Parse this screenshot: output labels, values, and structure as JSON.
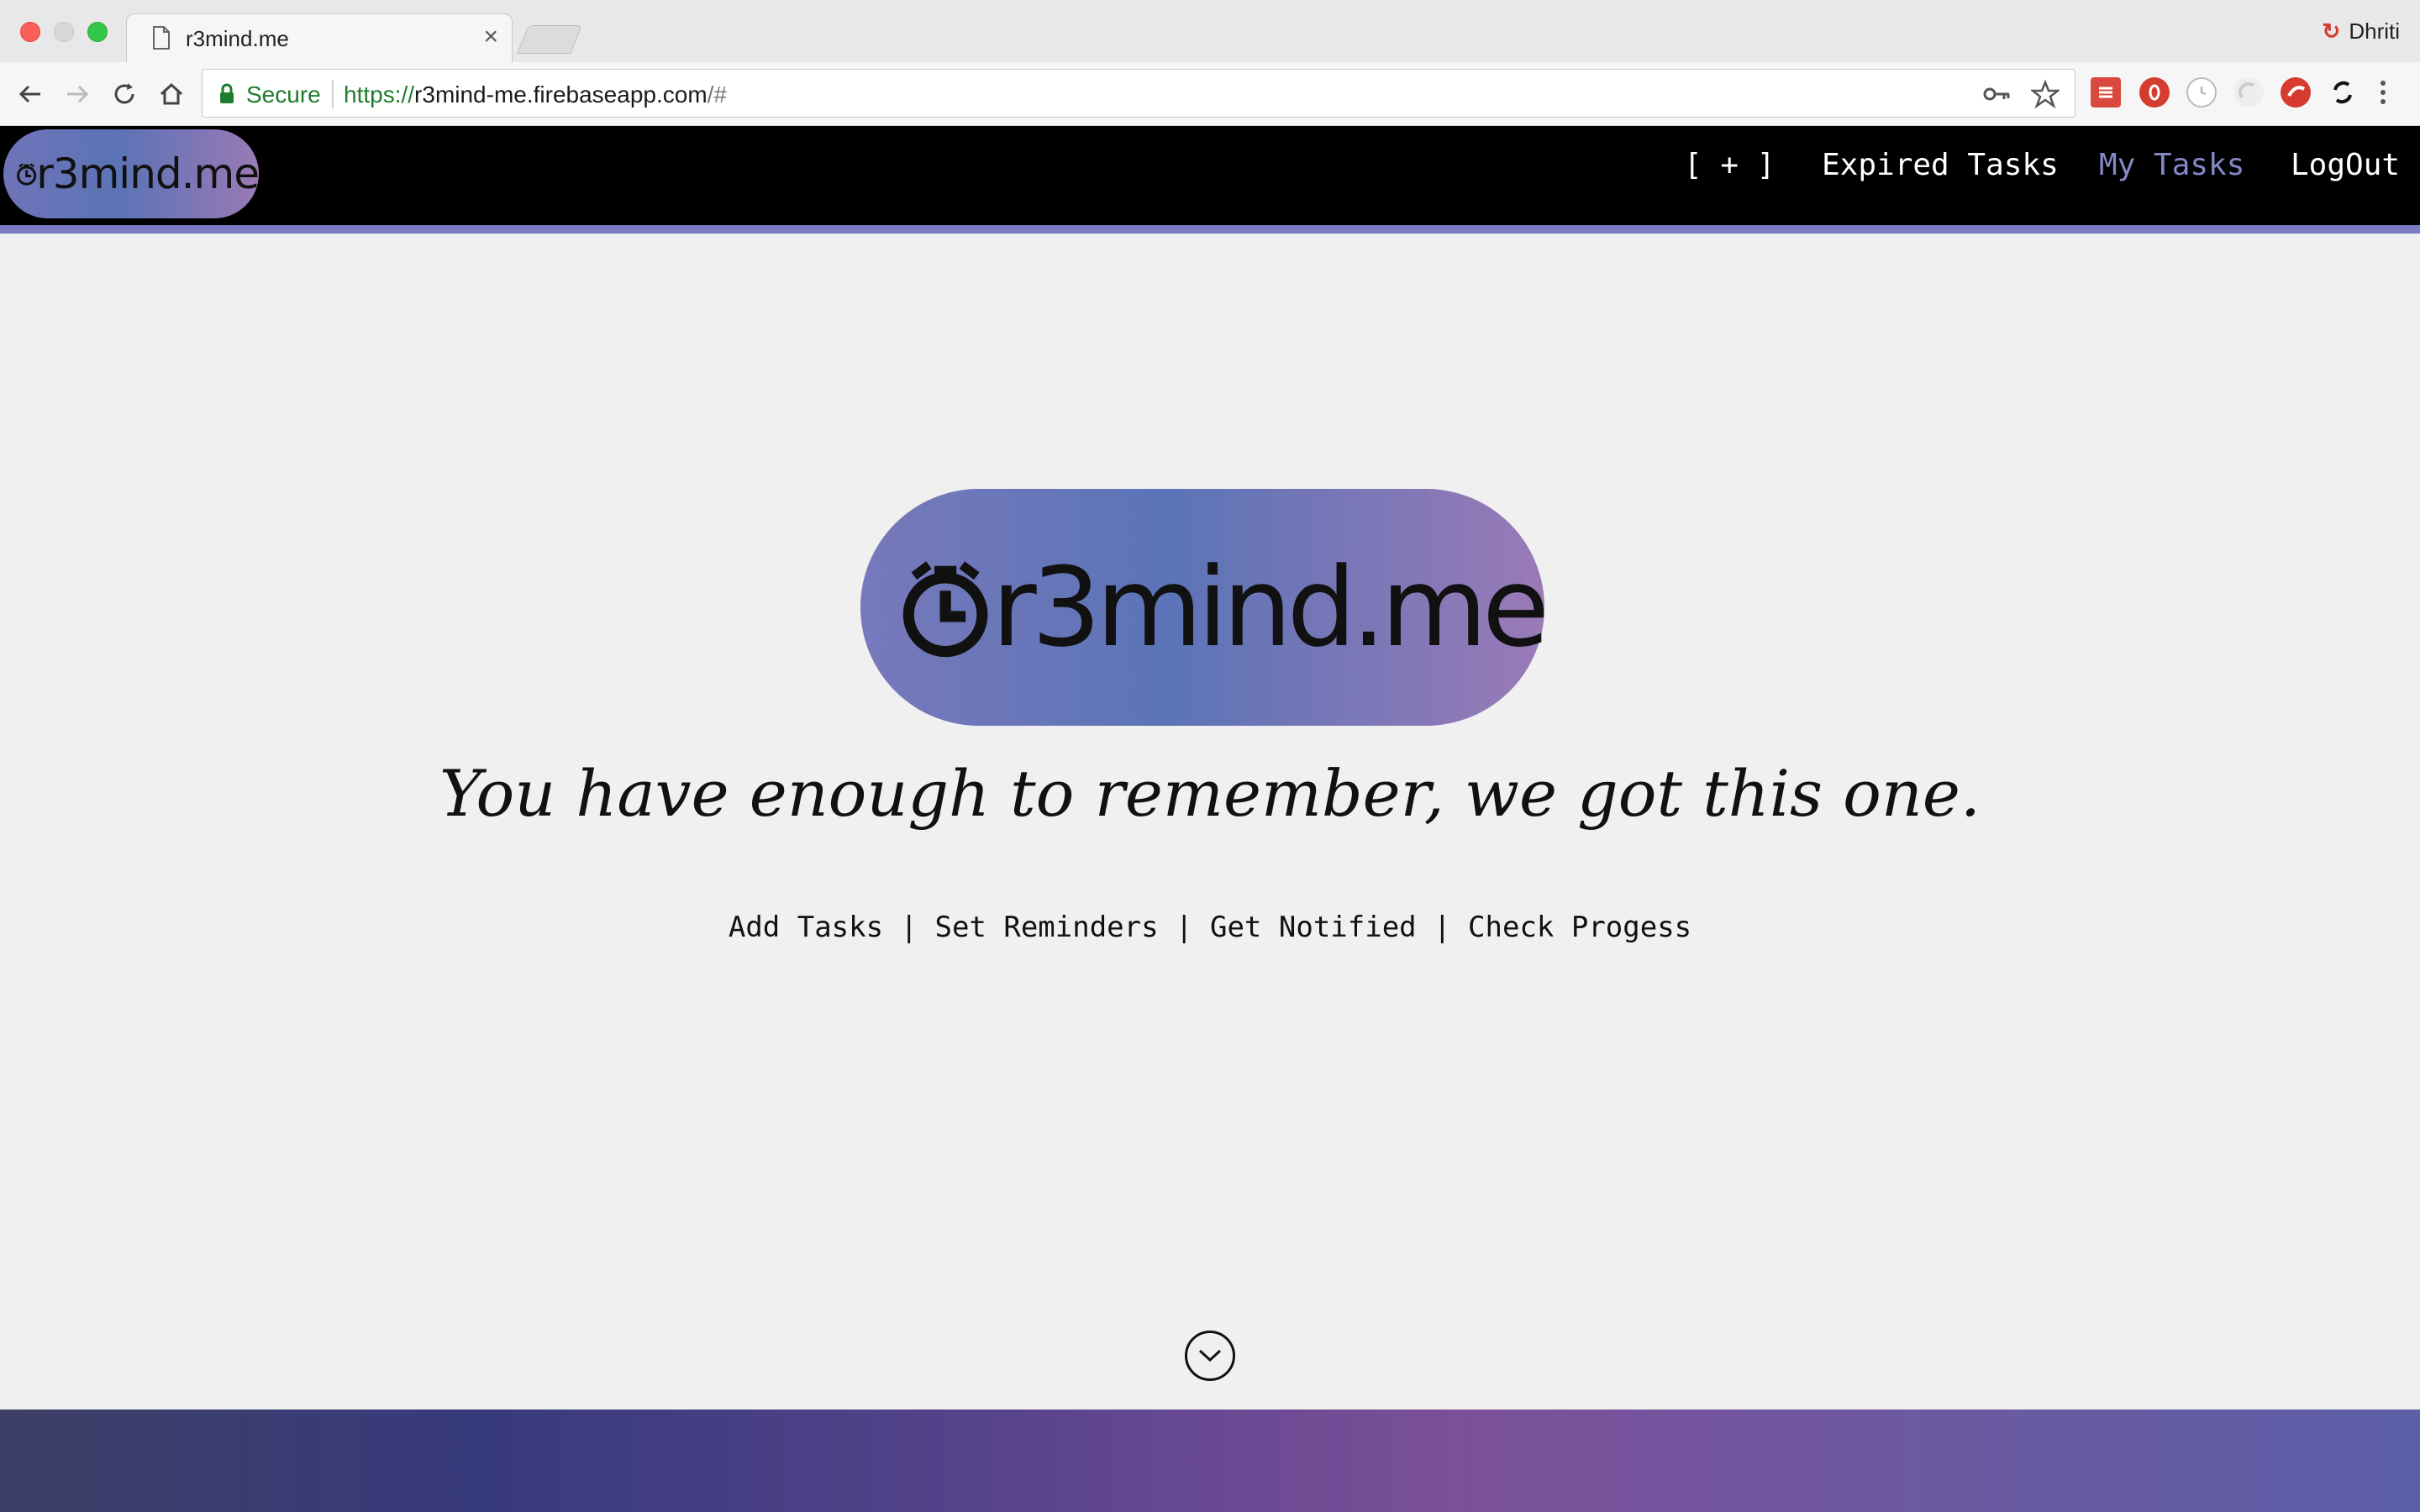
{
  "browser": {
    "tab_title": "r3mind.me",
    "tab_close": "×",
    "profile_name": "Dhriti",
    "security_label": "Secure",
    "url_scheme": "https://",
    "url_host": "r3mind-me.firebaseapp.com",
    "url_rest": "/#",
    "extensions": [
      "todoist-icon",
      "adblock-icon",
      "clock-icon",
      "shield-icon",
      "lastpass-icon",
      "sync-icon"
    ]
  },
  "site": {
    "logo_text": "r3mind.me",
    "nav": {
      "add_label": "[ + ]",
      "expired_label": "Expired Tasks",
      "my_tasks_label": "My Tasks",
      "logout_label": "LogOut"
    },
    "hero": {
      "logo_text": "r3mind.me",
      "tagline": "You have enough to remember, we got this one.",
      "features": "Add Tasks | Set Reminders | Get Notified | Check Progess"
    }
  },
  "colors": {
    "accent": "#8488c8",
    "nav_bar": "#000000",
    "secure_green": "#1e7d2c"
  }
}
